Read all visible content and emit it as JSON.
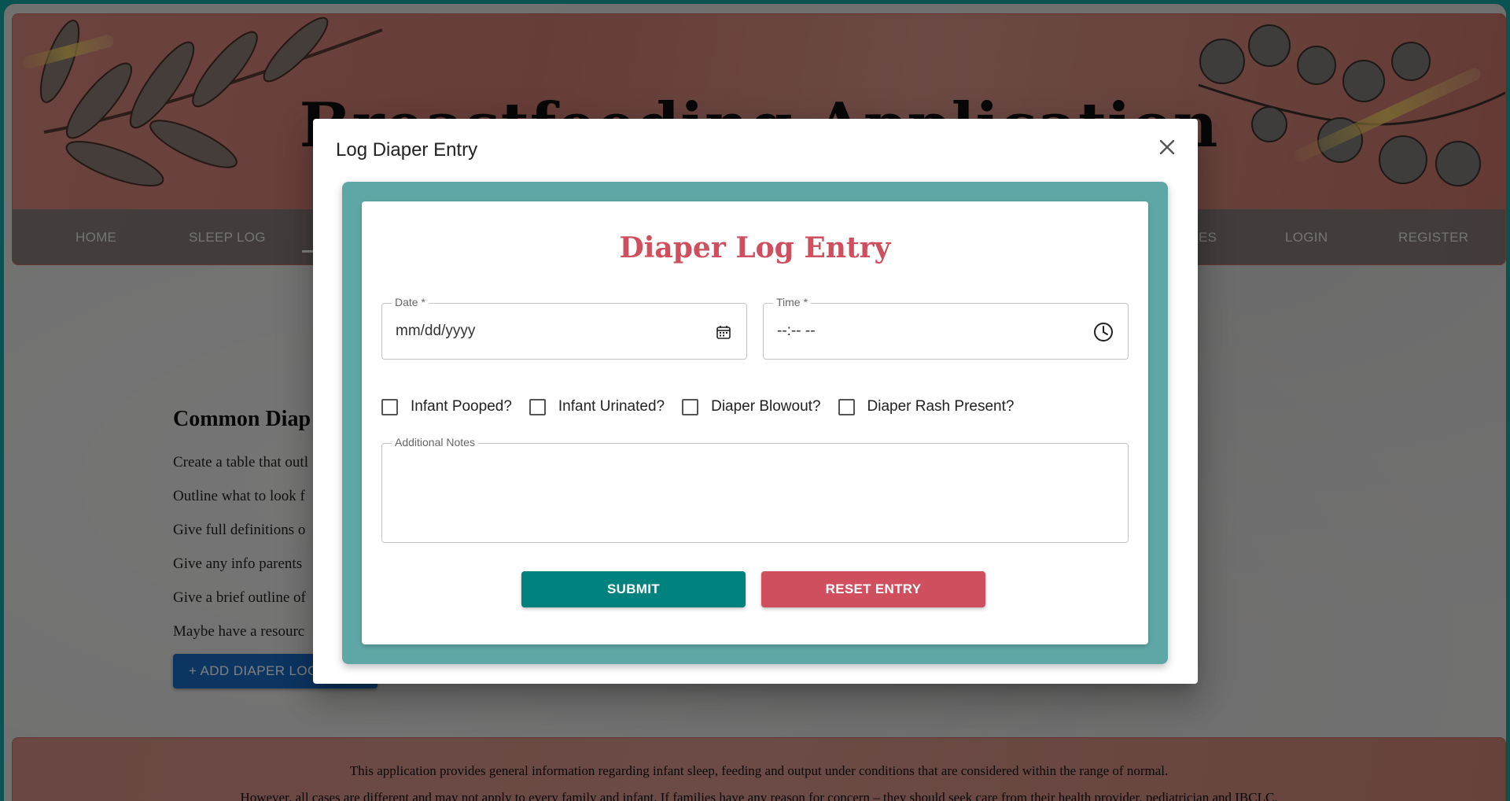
{
  "colors": {
    "frame": "#16a7a2",
    "brand_red": "#cf4f5e",
    "teal": "#00827f",
    "reset_red": "#cf4f5e",
    "add_blue": "#1b6bc4"
  },
  "background_page": {
    "banner_title": "Breastfeeding Application",
    "nav": {
      "items": [
        "HOME",
        "SLEEP LOG",
        "ES",
        "LOGIN",
        "REGISTER"
      ]
    },
    "content": {
      "heading": "Common Diap",
      "lines": [
        "Create a table that outl",
        "Outline what to look f",
        "Give full definitions o",
        "Give any info parents",
        "Give a brief outline of",
        "Maybe have a resourc"
      ],
      "add_button_label": "+ ADD DIAPER LOG"
    },
    "footer": {
      "lines": [
        "This application provides general information regarding infant sleep, feeding and output under conditions that are considered within the range of normal.",
        "However, all cases are different and may not apply to every family and infant. If families have any reason for concern – they should seek care from their health provider, pediatrician and IBCLC."
      ]
    }
  },
  "modal": {
    "title": "Log Diaper Entry",
    "close_icon": "close-icon",
    "form": {
      "title": "Diaper Log Entry",
      "date": {
        "label": "Date *",
        "placeholder": "mm/dd/yyyy",
        "icon": "calendar-icon"
      },
      "time": {
        "label": "Time *",
        "placeholder": "--:-- --",
        "icon": "clock-icon"
      },
      "checkboxes": [
        {
          "label": "Infant Pooped?",
          "checked": false
        },
        {
          "label": "Infant Urinated?",
          "checked": false
        },
        {
          "label": "Diaper Blowout?",
          "checked": false
        },
        {
          "label": "Diaper Rash Present?",
          "checked": false
        }
      ],
      "notes": {
        "label": "Additional Notes",
        "value": ""
      },
      "submit_label": "SUBMIT",
      "reset_label": "RESET ENTRY"
    }
  }
}
